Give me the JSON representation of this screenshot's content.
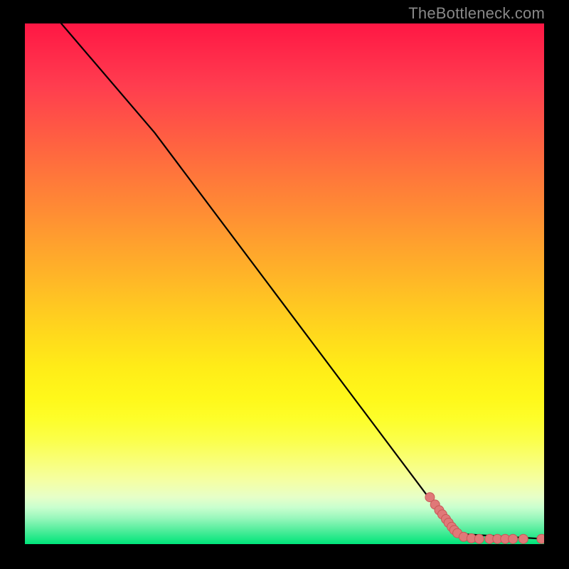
{
  "attribution": "TheBottleneck.com",
  "colors": {
    "line": "#000000",
    "marker_fill": "#e07878",
    "marker_stroke": "#c85858"
  },
  "chart_data": {
    "type": "line",
    "title": "",
    "xlabel": "",
    "ylabel": "",
    "xlim": [
      0,
      100
    ],
    "ylim": [
      0,
      100
    ],
    "series": [
      {
        "name": "curve",
        "style": "line",
        "points": [
          {
            "x": 7,
            "y": 100
          },
          {
            "x": 25,
            "y": 79
          },
          {
            "x": 83,
            "y": 2
          },
          {
            "x": 100,
            "y": 1
          }
        ]
      },
      {
        "name": "markers",
        "style": "scatter",
        "points": [
          {
            "x": 78.0,
            "y": 9.0
          },
          {
            "x": 79.0,
            "y": 7.6
          },
          {
            "x": 79.8,
            "y": 6.5
          },
          {
            "x": 80.4,
            "y": 5.7
          },
          {
            "x": 81.1,
            "y": 4.8
          },
          {
            "x": 81.6,
            "y": 4.1
          },
          {
            "x": 82.2,
            "y": 3.3
          },
          {
            "x": 82.7,
            "y": 2.7
          },
          {
            "x": 83.3,
            "y": 2.1
          },
          {
            "x": 84.5,
            "y": 1.4
          },
          {
            "x": 86.0,
            "y": 1.1
          },
          {
            "x": 87.5,
            "y": 1.0
          },
          {
            "x": 89.5,
            "y": 1.0
          },
          {
            "x": 91.0,
            "y": 1.0
          },
          {
            "x": 92.5,
            "y": 1.0
          },
          {
            "x": 94.0,
            "y": 1.0
          },
          {
            "x": 96.0,
            "y": 1.0
          },
          {
            "x": 99.5,
            "y": 1.0
          }
        ]
      }
    ]
  }
}
